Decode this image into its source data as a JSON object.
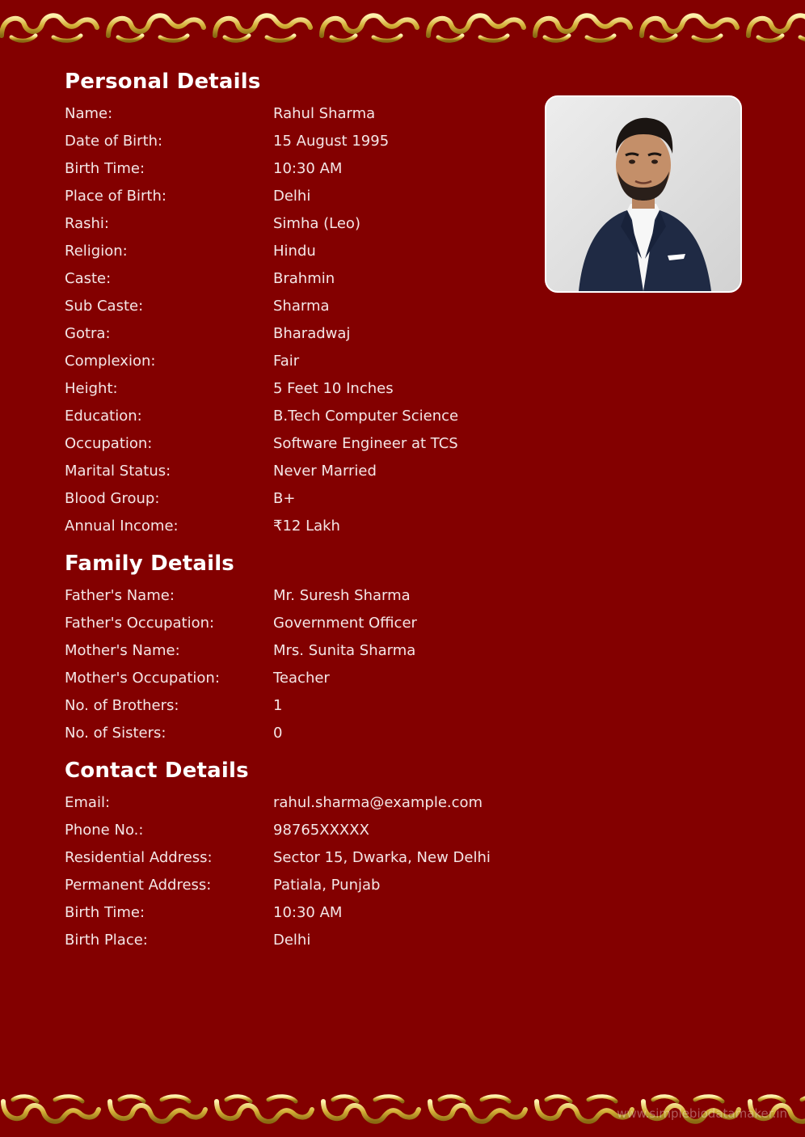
{
  "sections": {
    "personal": {
      "title": "Personal Details",
      "rows": [
        {
          "label": "Name:",
          "value": "Rahul Sharma"
        },
        {
          "label": "Date of Birth:",
          "value": "15 August 1995"
        },
        {
          "label": "Birth Time:",
          "value": "10:30 AM"
        },
        {
          "label": "Place of Birth:",
          "value": "Delhi"
        },
        {
          "label": "Rashi:",
          "value": "Simha (Leo)"
        },
        {
          "label": "Religion:",
          "value": "Hindu"
        },
        {
          "label": "Caste:",
          "value": "Brahmin"
        },
        {
          "label": "Sub Caste:",
          "value": "Sharma"
        },
        {
          "label": "Gotra:",
          "value": "Bharadwaj"
        },
        {
          "label": "Complexion:",
          "value": "Fair"
        },
        {
          "label": "Height:",
          "value": "5 Feet 10 Inches"
        },
        {
          "label": "Education:",
          "value": "B.Tech Computer Science"
        },
        {
          "label": "Occupation:",
          "value": "Software Engineer at TCS"
        },
        {
          "label": "Marital Status:",
          "value": "Never Married"
        },
        {
          "label": "Blood Group:",
          "value": "B+"
        },
        {
          "label": "Annual Income:",
          "value": "₹12 Lakh"
        }
      ]
    },
    "family": {
      "title": "Family Details",
      "rows": [
        {
          "label": "Father's Name:",
          "value": "Mr. Suresh Sharma"
        },
        {
          "label": "Father's Occupation:",
          "value": "Government Officer"
        },
        {
          "label": "Mother's Name:",
          "value": "Mrs. Sunita Sharma"
        },
        {
          "label": "Mother's Occupation:",
          "value": "Teacher"
        },
        {
          "label": "No. of Brothers:",
          "value": "1"
        },
        {
          "label": "No. of Sisters:",
          "value": "0"
        }
      ]
    },
    "contact": {
      "title": "Contact Details",
      "rows": [
        {
          "label": "Email:",
          "value": "rahul.sharma@example.com"
        },
        {
          "label": "Phone No.:",
          "value": "98765XXXXX"
        },
        {
          "label": "Residential Address:",
          "value": "Sector 15, Dwarka, New Delhi"
        },
        {
          "label": "Permanent Address:",
          "value": "Patiala, Punjab"
        },
        {
          "label": "Birth Time:",
          "value": "10:30 AM"
        },
        {
          "label": "Birth Place:",
          "value": "Delhi"
        }
      ]
    }
  },
  "watermark": "www.simplebiodatamaker.in",
  "colors": {
    "background": "#830000",
    "text": "#ffffff",
    "border_gold": "#d4af37"
  }
}
